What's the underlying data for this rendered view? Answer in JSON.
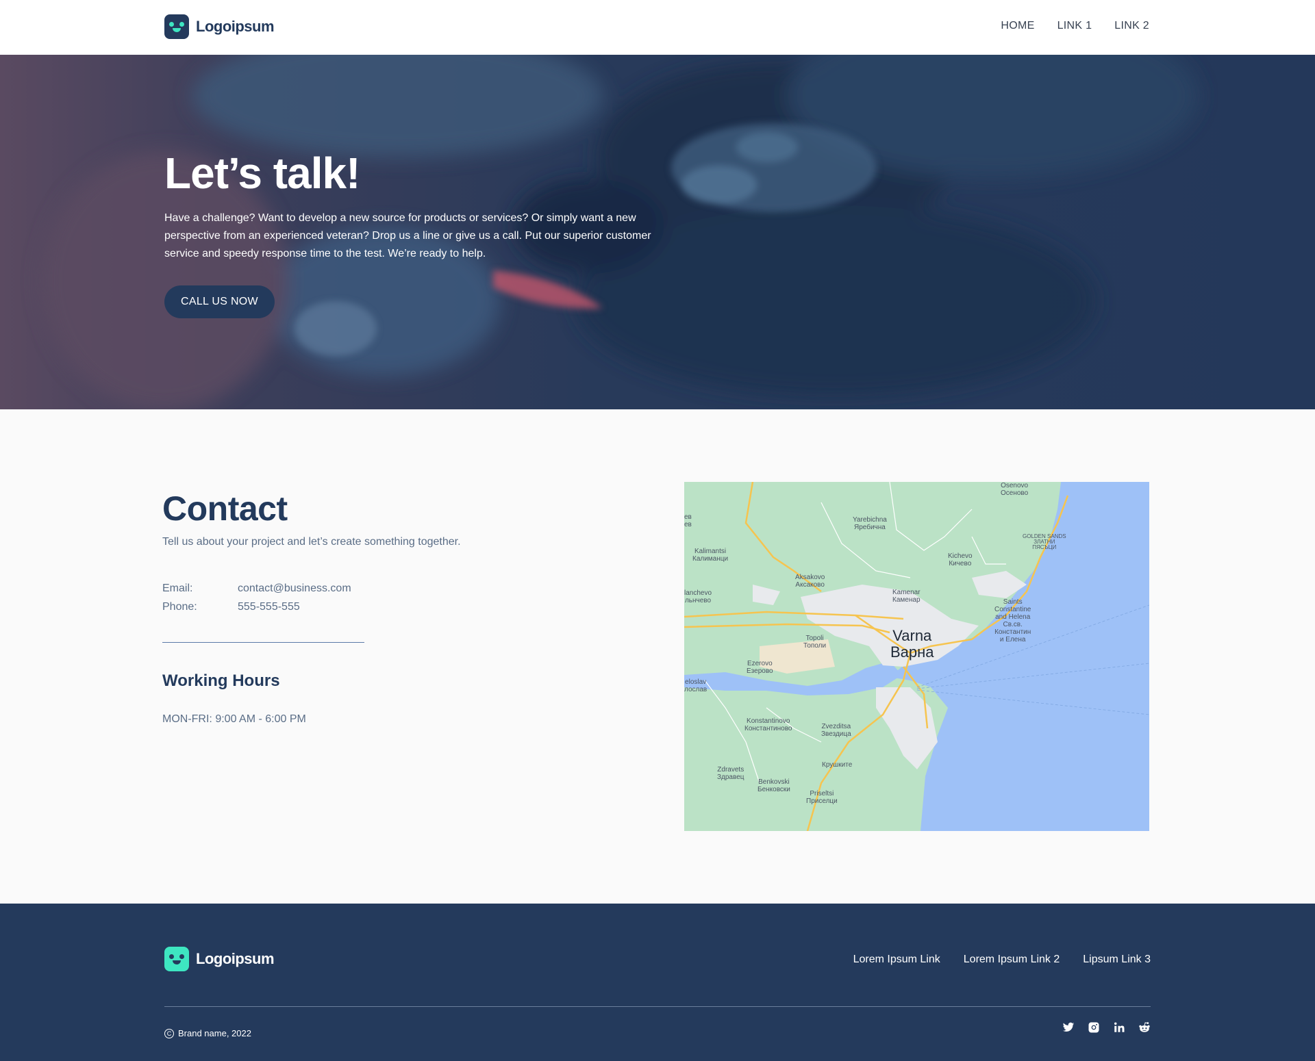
{
  "header": {
    "logo_text": "Logoipsum",
    "nav": [
      "HOME",
      "LINK 1",
      "LINK 2"
    ]
  },
  "hero": {
    "title": "Let’s talk!",
    "text": "Have a challenge? Want to develop a new source for products or services? Or simply want a new perspective from an experienced veteran? Drop us a line or give us a call. Put our superior customer service and speedy response time to the test. We’re ready to help.",
    "cta_label": "CALL US NOW"
  },
  "contact": {
    "title": "Contact",
    "subtitle": "Tell us about your project and let’s create something together.",
    "email_label": "Email:",
    "email_value": "contact@business.com",
    "phone_label": "Phone:",
    "phone_value": "555-555-555",
    "hours_title": "Working Hours",
    "hours_text": "MON-FRI: 9:00 AM - 6:00 PM"
  },
  "map": {
    "city": "Varna\nВарна",
    "labels": [
      "Osenovo\nОсеново",
      "Yarebichna\nЯребична",
      "Kalimantsi\nКалиманци",
      "Kichevo\nКичево",
      "GOLDEN SANDS\nЗЛАТНИ\nПЯСЪЦИ",
      "Aksakovo\nАксаково",
      "Kamenar\nКаменар",
      "Saints\nConstantine\nand Helena\nСв.св.\nКонстантин\nи Елена",
      "lanchevo\nльнчево",
      "Topoli\nТополи",
      "Ezerovo\nЕзерово",
      "eloslav\nлослав",
      "Konstantinovo\nКонстантиново",
      "Zvezditsa\nЗвездица",
      "Крушките",
      "Zdravets\nЗдравец",
      "Benkovski\nБенковски",
      "Priseltsi\nПриселци",
      "ев\nев"
    ],
    "colors": {
      "land": "#bbe2c6",
      "sea": "#9ec1f7",
      "urban": "#e8eaed",
      "road": "#f6c44f"
    }
  },
  "footer": {
    "logo_text": "Logoipsum",
    "links": [
      "Lorem Ipsum Link",
      "Lorem Ipsum Link 2",
      "Lipsum Link 3"
    ],
    "copyright_symbol": "C",
    "copyright": "Brand name, 2022",
    "social_icons": [
      "twitter-icon",
      "instagram-icon",
      "linkedin-icon",
      "reddit-icon"
    ]
  },
  "colors": {
    "brand_dark": "#243a5c",
    "accent": "#3ee6c1",
    "muted_text": "#5a6d86"
  }
}
